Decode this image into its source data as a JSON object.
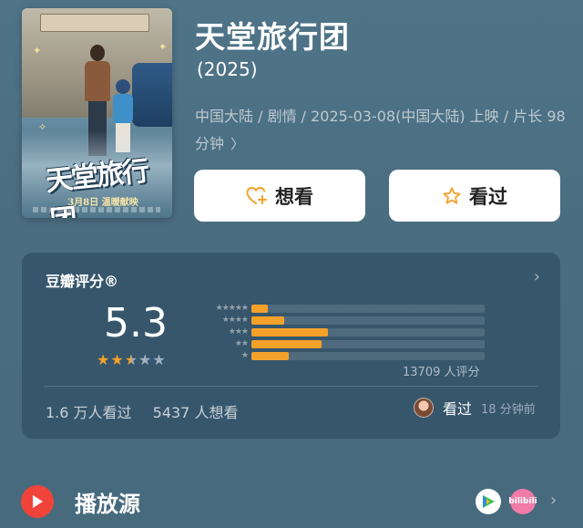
{
  "movie": {
    "title": "天堂旅行团",
    "year": "(2025)",
    "meta": "中国大陆 / 剧情 / 2025-03-08(中国大陆) 上映 / 片长 98 分钟",
    "meta_chevron": "〉"
  },
  "poster": {
    "title_art": "天堂旅行团",
    "date_line": "3月8日 温暖献映"
  },
  "actions": {
    "want_label": "想看",
    "seen_label": "看过"
  },
  "rating": {
    "section_title": "豆瓣评分®",
    "score": "5.3",
    "score_stars": 2.5,
    "distribution_fractions": [
      0.07,
      0.14,
      0.33,
      0.3,
      0.16
    ],
    "count_label": "13709 人评分",
    "watched": "1.6 万人看过",
    "want_to_watch": "5437 人想看",
    "friend_action": "看过",
    "friend_time": "18 分钟前"
  },
  "play_source": {
    "label": "播放源",
    "source2_text": "bilibili"
  },
  "colors": {
    "bar": "#f4a12a",
    "star_on": "#f4a12a",
    "star_off": "#9fb1bd",
    "play": "#f0443b"
  }
}
